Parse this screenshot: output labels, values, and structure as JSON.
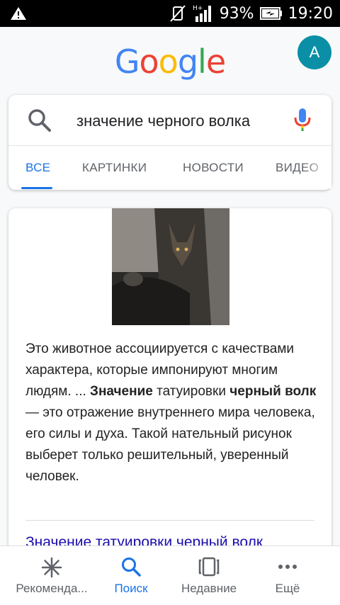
{
  "status_bar": {
    "battery": "93%",
    "time": "19:20"
  },
  "logo": [
    "G",
    "o",
    "o",
    "g",
    "l",
    "e"
  ],
  "logo_colors": [
    "#4285f4",
    "#ea4335",
    "#fbbc05",
    "#4285f4",
    "#34a853",
    "#ea4335"
  ],
  "avatar": {
    "letter": "A",
    "color": "#0a8fa6"
  },
  "search": {
    "query": "значение черного волка"
  },
  "tabs": [
    {
      "label": "ВСЕ",
      "active": true
    },
    {
      "label": "КАРТИНКИ",
      "active": false
    },
    {
      "label": "НОВОСТИ",
      "active": false
    },
    {
      "label": "ВИДЕО",
      "active": false
    }
  ],
  "result": {
    "snippet_intro": "Это животное ассоциируется с качествами характера, которые импонируют многим людям. ...",
    "snippet_bold_1": "Значение",
    "snippet_mid": " татуировки ",
    "snippet_bold_2": "черный волк",
    "snippet_rest": " — это отражение внутреннего мира человека, его силы и духа. Такой нательный рисунок выберет только решительный, уверенный человек.",
    "link_title": "Значение татуировки черный волк"
  },
  "bottom_nav": [
    {
      "label": "Рекоменда...",
      "icon": "asterisk-icon",
      "active": false
    },
    {
      "label": "Поиск",
      "icon": "search-icon",
      "active": true
    },
    {
      "label": "Недавние",
      "icon": "recent-tabs-icon",
      "active": false
    },
    {
      "label": "Ещё",
      "icon": "more-dots-icon",
      "active": false
    }
  ],
  "colors": {
    "accent": "#1a73e8",
    "link": "#1a0dab"
  }
}
